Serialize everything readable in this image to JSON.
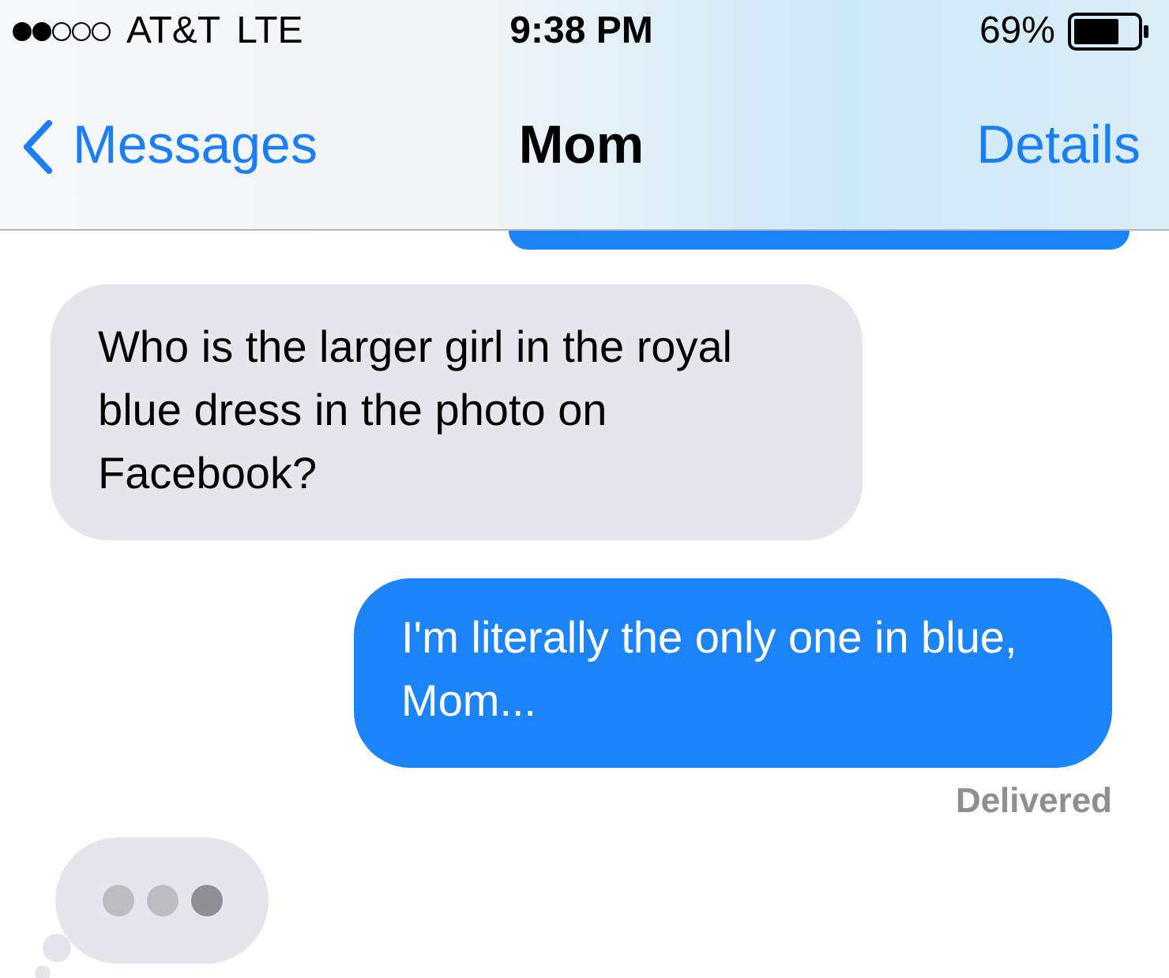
{
  "status_bar": {
    "carrier": "AT&T",
    "network": "LTE",
    "time": "9:38 PM",
    "battery": "69%"
  },
  "nav_bar": {
    "back": "Messages",
    "title": "Mom",
    "action": "Details"
  },
  "messages": [
    {
      "kind": "sent-partial"
    },
    {
      "kind": "received",
      "text": "Who is the larger girl in the royal blue dress in the photo on Facebook?"
    },
    {
      "kind": "sent",
      "text": "I'm literally the only one in blue, Mom...",
      "status": "Delivered"
    },
    {
      "kind": "typing"
    }
  ]
}
